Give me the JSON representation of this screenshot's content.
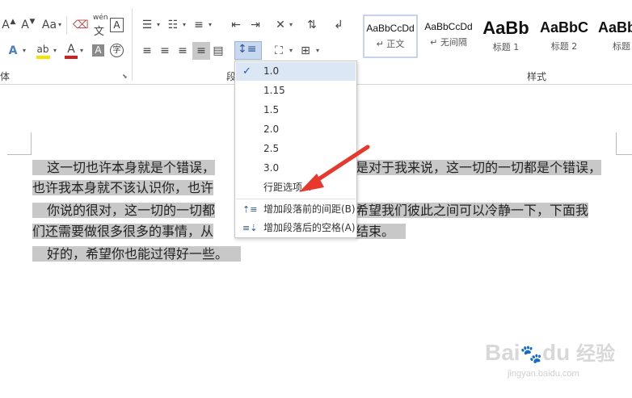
{
  "ribbon": {
    "font_group_label": "体",
    "paragraph_group_label": "段",
    "styles_group_label": "样式",
    "font_row1": {
      "grow_font": "A",
      "shrink_font": "A",
      "change_case": "Aa",
      "phonetic_top": "wén",
      "phonetic_bottom": "文",
      "char_border": "A"
    },
    "font_row2": {
      "text_effects": "A",
      "highlight": "ab",
      "font_color": "A",
      "char_shading": "A",
      "enclose_char": "字"
    }
  },
  "styles": [
    {
      "sample": "AaBbCcDd",
      "name": "正文",
      "prefix": "↵",
      "selected": true,
      "size": "small"
    },
    {
      "sample": "AaBbCcDd",
      "name": "无间隔",
      "prefix": "↵",
      "selected": false,
      "size": "small"
    },
    {
      "sample": "AaBb",
      "name": "标题 1",
      "prefix": "",
      "selected": false,
      "size": "large"
    },
    {
      "sample": "AaBbC",
      "name": "标题 2",
      "prefix": "",
      "selected": false,
      "size": "medium"
    },
    {
      "sample": "AaBbC",
      "name": "标题",
      "prefix": "",
      "selected": false,
      "size": "medium"
    }
  ],
  "line_spacing_menu": {
    "options": [
      {
        "label": "1.0",
        "checked": true
      },
      {
        "label": "1.15",
        "checked": false
      },
      {
        "label": "1.5",
        "checked": false
      },
      {
        "label": "2.0",
        "checked": false
      },
      {
        "label": "2.5",
        "checked": false
      },
      {
        "label": "3.0",
        "checked": false
      }
    ],
    "line_spacing_options": "行距选项...",
    "add_space_before": "增加段落前的间距(B)",
    "add_space_after": "增加段落后的空格(A)"
  },
  "document": {
    "lines": [
      {
        "left": "这一切也许本身就是个错误，",
        "right": "是对于我来说，这一切的一切都是个错误，"
      },
      {
        "left": "也许我本身就不该认识你，也许",
        "right": ""
      },
      {
        "left": "你说的很对，这一切的一切都",
        "right": "希望我们彼此之间可以冷静一下，下面我"
      },
      {
        "left": "们还需要做很多很多的事情，从",
        "right": "结束。"
      },
      {
        "left": "好的，希望你也能过得好一些。",
        "right": ""
      }
    ]
  },
  "watermark": {
    "logo_text": "Bai",
    "logo_text2": "du",
    "brand_cn": "经验",
    "url": "jingyan.baidu.com"
  },
  "colors": {
    "highlight_gray": "#c8c8c8",
    "arrow_red": "#e8372c",
    "font_color_red": "#d11f1f",
    "highlighter_yellow": "#f5e400",
    "accent_blue": "#2b579a"
  }
}
